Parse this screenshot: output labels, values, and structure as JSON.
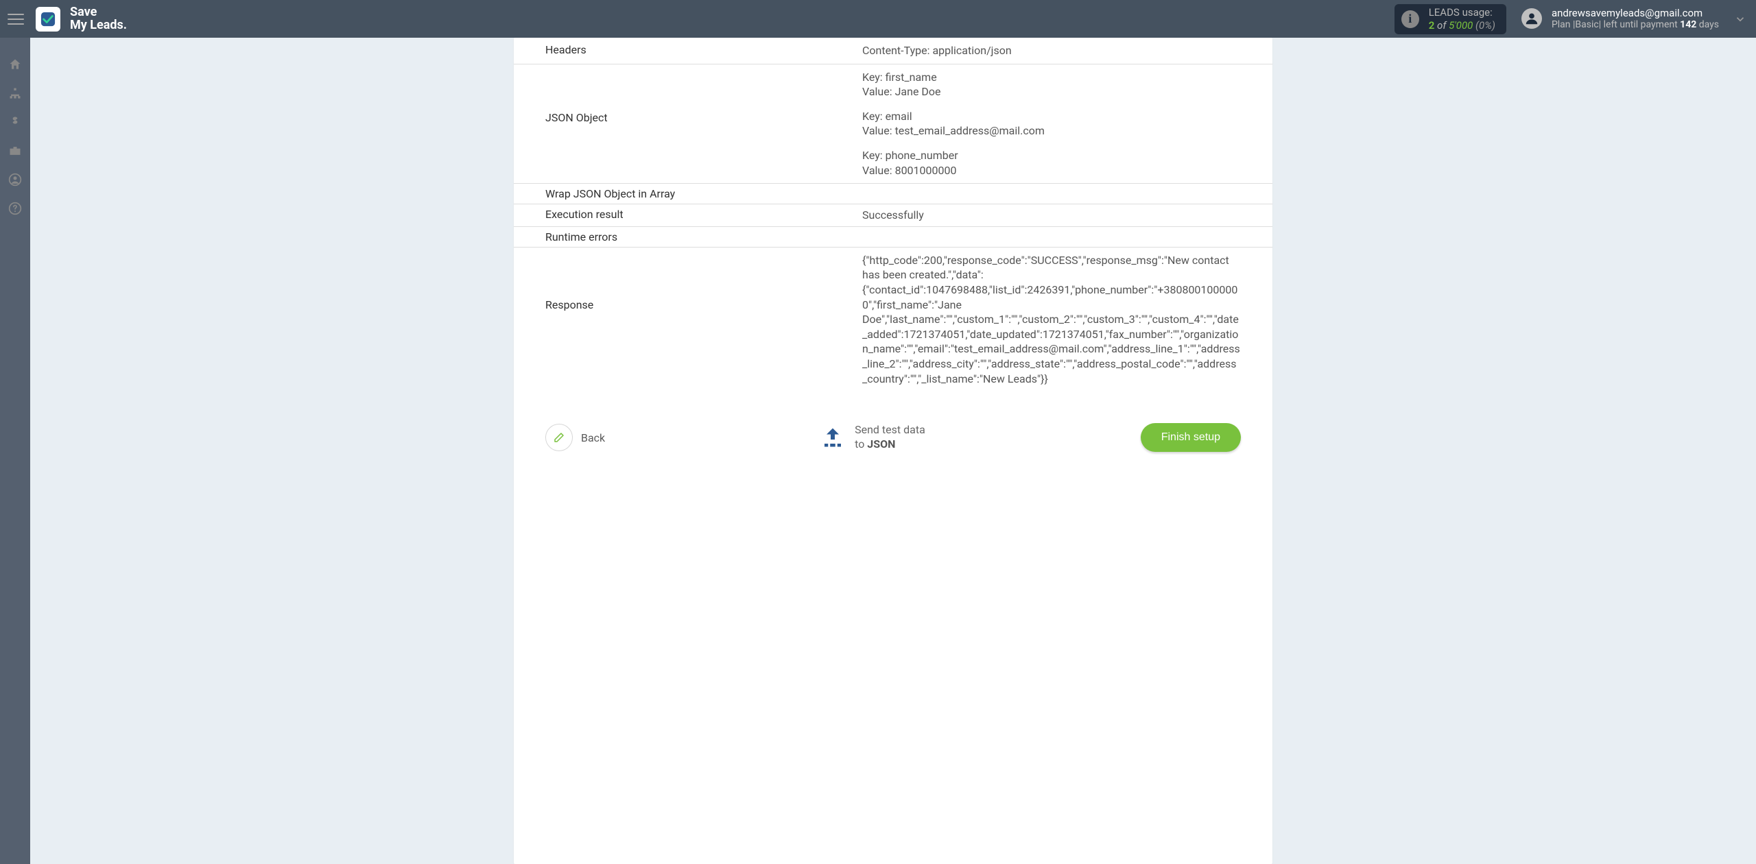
{
  "brand": {
    "line1": "Save",
    "line2": "My Leads."
  },
  "usage": {
    "label": "LEADS usage:",
    "count": "2",
    "of_word": "of",
    "limit": "5'000",
    "percent": "(0%)"
  },
  "account": {
    "email": "andrewsavemyleads@gmail.com",
    "plan_prefix": "Plan |",
    "plan_name": "Basic",
    "plan_suffix_pre": "| left until payment ",
    "days": "142",
    "plan_suffix_post": " days"
  },
  "rows": {
    "headers": {
      "label": "Headers",
      "value": "Content-Type: application/json"
    },
    "json_object": {
      "label": "JSON Object",
      "pairs": [
        {
          "key_label": "Key: first_name",
          "value_label": "Value: Jane Doe"
        },
        {
          "key_label": "Key: email",
          "value_label": "Value: test_email_address@mail.com"
        },
        {
          "key_label": "Key: phone_number",
          "value_label": "Value: 8001000000"
        }
      ]
    },
    "wrap": {
      "label": "Wrap JSON Object in Array",
      "value": ""
    },
    "exec": {
      "label": "Execution result",
      "value": "Successfully"
    },
    "runtime": {
      "label": "Runtime errors",
      "value": ""
    },
    "response": {
      "label": "Response",
      "value": "{\"http_code\":200,\"response_code\":\"SUCCESS\",\"response_msg\":\"New contact has been created.\",\"data\":{\"contact_id\":1047698488,\"list_id\":2426391,\"phone_number\":\"+3808001000000\",\"first_name\":\"Jane Doe\",\"last_name\":\"\",\"custom_1\":\"\",\"custom_2\":\"\",\"custom_3\":\"\",\"custom_4\":\"\",\"date_added\":1721374051,\"date_updated\":1721374051,\"fax_number\":\"\",\"organization_name\":\"\",\"email\":\"test_email_address@mail.com\",\"address_line_1\":\"\",\"address_line_2\":\"\",\"address_city\":\"\",\"address_state\":\"\",\"address_postal_code\":\"\",\"address_country\":\"\",\"_list_name\":\"New Leads\"}}"
    }
  },
  "footer": {
    "back": "Back",
    "send_line1": "Send test data",
    "send_line2_pre": "to ",
    "send_line2_bold": "JSON",
    "finish": "Finish setup"
  }
}
